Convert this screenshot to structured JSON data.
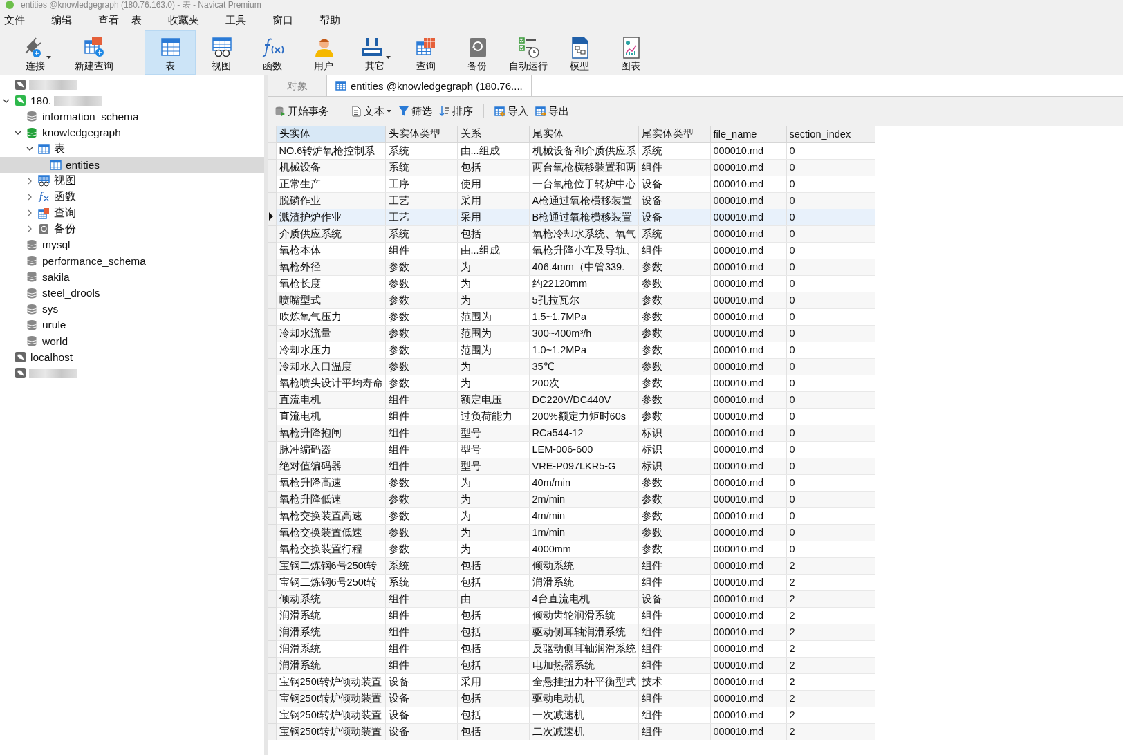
{
  "window": {
    "title": "entities @knowledgegraph (180.76.163.0) - 表 - Navicat Premium"
  },
  "menu": [
    "文件",
    "编辑",
    "查看",
    "表",
    "收藏夹",
    "工具",
    "窗口",
    "帮助"
  ],
  "toolbar": [
    {
      "kind": "connect",
      "label": "连接",
      "dropdown": true,
      "selected": false
    },
    {
      "kind": "newquery",
      "label": "新建查询",
      "dropdown": false,
      "selected": false
    },
    {
      "kind": "table",
      "label": "表",
      "dropdown": false,
      "selected": true
    },
    {
      "kind": "view",
      "label": "视图",
      "dropdown": false,
      "selected": false
    },
    {
      "kind": "function",
      "label": "函数",
      "dropdown": false,
      "selected": false
    },
    {
      "kind": "user",
      "label": "用户",
      "dropdown": false,
      "selected": false
    },
    {
      "kind": "other",
      "label": "其它",
      "dropdown": true,
      "selected": false
    },
    {
      "kind": "query",
      "label": "查询",
      "dropdown": false,
      "selected": false
    },
    {
      "kind": "backup",
      "label": "备份",
      "dropdown": false,
      "selected": false
    },
    {
      "kind": "automation",
      "label": "自动运行",
      "dropdown": false,
      "selected": false
    },
    {
      "kind": "model",
      "label": "模型",
      "dropdown": false,
      "selected": false
    },
    {
      "kind": "chart",
      "label": "图表",
      "dropdown": false,
      "selected": false
    }
  ],
  "sidebar": {
    "items": [
      {
        "kind": "connection",
        "redacted": true,
        "open": false,
        "selected": false
      },
      {
        "kind": "connection",
        "label": "180.",
        "redacted": true,
        "open": true,
        "expanded": true,
        "selected": false,
        "children": [
          {
            "kind": "database",
            "label": "information_schema",
            "open": false,
            "selected": false
          },
          {
            "kind": "database",
            "label": "knowledgegraph",
            "open": true,
            "expanded": true,
            "selected": false,
            "children": [
              {
                "kind": "tables",
                "label": "表",
                "expanded": true,
                "selected": false,
                "children": [
                  {
                    "kind": "table",
                    "label": "entities",
                    "selected": true
                  }
                ]
              },
              {
                "kind": "views",
                "label": "视图",
                "expanded": false,
                "selected": false
              },
              {
                "kind": "functions",
                "label": "函数",
                "expanded": false,
                "selected": false
              },
              {
                "kind": "queries",
                "label": "查询",
                "expanded": false,
                "selected": false
              },
              {
                "kind": "backups",
                "label": "备份",
                "expanded": false,
                "selected": false
              }
            ]
          },
          {
            "kind": "database",
            "label": "mysql",
            "open": false,
            "selected": false
          },
          {
            "kind": "database",
            "label": "performance_schema",
            "open": false,
            "selected": false
          },
          {
            "kind": "database",
            "label": "sakila",
            "open": false,
            "selected": false
          },
          {
            "kind": "database",
            "label": "steel_drools",
            "open": false,
            "selected": false
          },
          {
            "kind": "database",
            "label": "sys",
            "open": false,
            "selected": false
          },
          {
            "kind": "database",
            "label": "urule",
            "open": false,
            "selected": false
          },
          {
            "kind": "database",
            "label": "world",
            "open": false,
            "selected": false
          }
        ]
      },
      {
        "kind": "connection",
        "label": "localhost",
        "redacted": false,
        "open": false,
        "selected": false
      },
      {
        "kind": "connection",
        "redacted": true,
        "open": false,
        "selected": false
      }
    ]
  },
  "tabs": [
    {
      "label": "对象",
      "selected": false
    },
    {
      "label": "entities @knowledgegraph (180.76....",
      "selected": true
    }
  ],
  "data_toolbar": [
    {
      "kind": "transaction",
      "label": "开始事务",
      "dropdown": false
    },
    {
      "kind": "text",
      "label": "文本",
      "dropdown": true
    },
    {
      "kind": "filter",
      "label": "筛选",
      "dropdown": false
    },
    {
      "kind": "sort",
      "label": "排序",
      "dropdown": false
    },
    {
      "kind": "import",
      "label": "导入",
      "dropdown": false
    },
    {
      "kind": "export",
      "label": "导出",
      "dropdown": false
    }
  ],
  "table": {
    "columns": [
      {
        "label": "头实体",
        "selected": true
      },
      {
        "label": "头实体类型",
        "selected": false
      },
      {
        "label": "关系",
        "selected": false
      },
      {
        "label": "尾实体",
        "selected": false
      },
      {
        "label": "尾实体类型",
        "selected": false
      },
      {
        "label": "file_name",
        "selected": false
      },
      {
        "label": "section_index",
        "selected": false
      }
    ],
    "rows": [
      {
        "selected": false,
        "cells": [
          "NO.6转炉氧枪控制系",
          "系统",
          "由...组成",
          "机械设备和介质供应系",
          "系统",
          "000010.md",
          "0"
        ]
      },
      {
        "selected": false,
        "cells": [
          "机械设备",
          "系统",
          "包括",
          "两台氧枪横移装置和两",
          "组件",
          "000010.md",
          "0"
        ]
      },
      {
        "selected": false,
        "cells": [
          "正常生产",
          "工序",
          "使用",
          "一台氧枪位于转炉中心",
          "设备",
          "000010.md",
          "0"
        ]
      },
      {
        "selected": false,
        "cells": [
          "脱磷作业",
          "工艺",
          "采用",
          "A枪通过氧枪横移装置",
          "设备",
          "000010.md",
          "0"
        ]
      },
      {
        "selected": true,
        "cells": [
          "溅渣护炉作业",
          "工艺",
          "采用",
          "B枪通过氧枪横移装置",
          "设备",
          "000010.md",
          "0"
        ]
      },
      {
        "selected": false,
        "cells": [
          "介质供应系统",
          "系统",
          "包括",
          "氧枪冷却水系统、氧气",
          "系统",
          "000010.md",
          "0"
        ]
      },
      {
        "selected": false,
        "cells": [
          "氧枪本体",
          "组件",
          "由...组成",
          "氧枪升降小车及导轨、",
          "组件",
          "000010.md",
          "0"
        ]
      },
      {
        "selected": false,
        "cells": [
          "氧枪外径",
          "参数",
          "为",
          "406.4mm（中管339.",
          "参数",
          "000010.md",
          "0"
        ]
      },
      {
        "selected": false,
        "cells": [
          "氧枪长度",
          "参数",
          "为",
          "约22120mm",
          "参数",
          "000010.md",
          "0"
        ]
      },
      {
        "selected": false,
        "cells": [
          "喷嘴型式",
          "参数",
          "为",
          "5孔拉瓦尔",
          "参数",
          "000010.md",
          "0"
        ]
      },
      {
        "selected": false,
        "cells": [
          "吹炼氧气压力",
          "参数",
          "范围为",
          "1.5~1.7MPa",
          "参数",
          "000010.md",
          "0"
        ]
      },
      {
        "selected": false,
        "cells": [
          "冷却水流量",
          "参数",
          "范围为",
          "300~400m³/h",
          "参数",
          "000010.md",
          "0"
        ]
      },
      {
        "selected": false,
        "cells": [
          "冷却水压力",
          "参数",
          "范围为",
          "1.0~1.2MPa",
          "参数",
          "000010.md",
          "0"
        ]
      },
      {
        "selected": false,
        "cells": [
          "冷却水入口温度",
          "参数",
          "为",
          "35℃",
          "参数",
          "000010.md",
          "0"
        ]
      },
      {
        "selected": false,
        "cells": [
          "氧枪喷头设计平均寿命",
          "参数",
          "为",
          "200次",
          "参数",
          "000010.md",
          "0"
        ]
      },
      {
        "selected": false,
        "cells": [
          "直流电机",
          "组件",
          "额定电压",
          "DC220V/DC440V",
          "参数",
          "000010.md",
          "0"
        ]
      },
      {
        "selected": false,
        "cells": [
          "直流电机",
          "组件",
          "过负荷能力",
          "200%额定力矩时60s",
          "参数",
          "000010.md",
          "0"
        ]
      },
      {
        "selected": false,
        "cells": [
          "氧枪升降抱闸",
          "组件",
          "型号",
          "RCa544-12",
          "标识",
          "000010.md",
          "0"
        ]
      },
      {
        "selected": false,
        "cells": [
          "脉冲编码器",
          "组件",
          "型号",
          "LEM-006-600",
          "标识",
          "000010.md",
          "0"
        ]
      },
      {
        "selected": false,
        "cells": [
          "绝对值编码器",
          "组件",
          "型号",
          "VRE-P097LKR5-G",
          "标识",
          "000010.md",
          "0"
        ]
      },
      {
        "selected": false,
        "cells": [
          "氧枪升降高速",
          "参数",
          "为",
          "40m/min",
          "参数",
          "000010.md",
          "0"
        ]
      },
      {
        "selected": false,
        "cells": [
          "氧枪升降低速",
          "参数",
          "为",
          "2m/min",
          "参数",
          "000010.md",
          "0"
        ]
      },
      {
        "selected": false,
        "cells": [
          "氧枪交换装置高速",
          "参数",
          "为",
          "4m/min",
          "参数",
          "000010.md",
          "0"
        ]
      },
      {
        "selected": false,
        "cells": [
          "氧枪交换装置低速",
          "参数",
          "为",
          "1m/min",
          "参数",
          "000010.md",
          "0"
        ]
      },
      {
        "selected": false,
        "cells": [
          "氧枪交换装置行程",
          "参数",
          "为",
          "4000mm",
          "参数",
          "000010.md",
          "0"
        ]
      },
      {
        "selected": false,
        "cells": [
          "宝钢二炼钢6号250t转",
          "系统",
          "包括",
          "倾动系统",
          "组件",
          "000010.md",
          "2"
        ]
      },
      {
        "selected": false,
        "cells": [
          "宝钢二炼钢6号250t转",
          "系统",
          "包括",
          "润滑系统",
          "组件",
          "000010.md",
          "2"
        ]
      },
      {
        "selected": false,
        "cells": [
          "倾动系统",
          "组件",
          "由",
          "4台直流电机",
          "设备",
          "000010.md",
          "2"
        ]
      },
      {
        "selected": false,
        "cells": [
          "润滑系统",
          "组件",
          "包括",
          "倾动齿轮润滑系统",
          "组件",
          "000010.md",
          "2"
        ]
      },
      {
        "selected": false,
        "cells": [
          "润滑系统",
          "组件",
          "包括",
          "驱动侧耳轴润滑系统",
          "组件",
          "000010.md",
          "2"
        ]
      },
      {
        "selected": false,
        "cells": [
          "润滑系统",
          "组件",
          "包括",
          "反驱动侧耳轴润滑系统",
          "组件",
          "000010.md",
          "2"
        ]
      },
      {
        "selected": false,
        "cells": [
          "润滑系统",
          "组件",
          "包括",
          "电加热器系统",
          "组件",
          "000010.md",
          "2"
        ]
      },
      {
        "selected": false,
        "cells": [
          "宝钢250t转炉倾动装置",
          "设备",
          "采用",
          "全悬挂扭力杆平衡型式",
          "技术",
          "000010.md",
          "2"
        ]
      },
      {
        "selected": false,
        "cells": [
          "宝钢250t转炉倾动装置",
          "设备",
          "包括",
          "驱动电动机",
          "组件",
          "000010.md",
          "2"
        ]
      },
      {
        "selected": false,
        "cells": [
          "宝钢250t转炉倾动装置",
          "设备",
          "包括",
          "一次减速机",
          "组件",
          "000010.md",
          "2"
        ]
      },
      {
        "selected": false,
        "cells": [
          "宝钢250t转炉倾动装置",
          "设备",
          "包括",
          "二次减速机",
          "组件",
          "000010.md",
          "2"
        ]
      }
    ]
  }
}
